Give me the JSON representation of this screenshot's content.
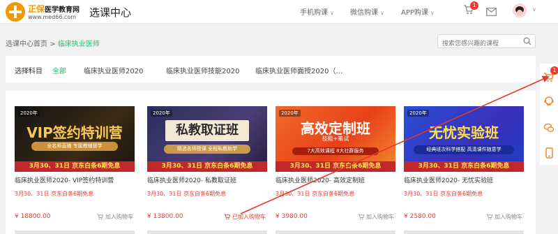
{
  "logo": {
    "brand_prefix": "正保",
    "brand_suffix": "医学教育网",
    "url": "www.med66.com"
  },
  "header": {
    "title": "选课中心",
    "nav": [
      {
        "label": "手机购课"
      },
      {
        "label": "微信购课"
      },
      {
        "label": "APP购课"
      }
    ],
    "cart_badge": "1"
  },
  "breadcrumb": {
    "home": "选课中心首页",
    "sep": ">",
    "current": "临床执业医师"
  },
  "search": {
    "placeholder": "搜索您感兴趣的课程"
  },
  "filter": {
    "label": "选择科目",
    "all": "全部",
    "options": [
      "临床执业医师2020",
      "临床执业医师技能2020",
      "临床执业医师面授2020（…"
    ]
  },
  "rail": {
    "cart_badge": "1"
  },
  "courses": [
    {
      "year": "2020年",
      "banner_title": "VIP签约特训营",
      "banner_sub": "全名师直播 专属教辅督学",
      "banner_strip": "3月30、31日  京东白条6期免息",
      "title": "临床执业医师2020- VIP签约特训营",
      "promo": "3月30、31日 京东白条6期免息",
      "price": "¥ 18800.00",
      "cart_label": "加入购物车"
    },
    {
      "year": "2020年",
      "banner_title": "私教取证班",
      "banner_sub": "精选名师授课 全程私教助学",
      "banner_strip": "3月30、31日  京东白条6期免息",
      "title": "临床执业医师2020- 私教取证班",
      "promo": "3月30、31日 京东白条6期免息",
      "price": "¥ 13800.00",
      "cart_label": "已加入购物车"
    },
    {
      "year": "2020年",
      "banner_title": "高效定制班",
      "banner_sub": "7大高效课程  8大社群服务",
      "banner_tag": "技能+笔试",
      "banner_strip": "3月30、31日  京东白条6期免息",
      "title": "临床执业医师2020- 高效定制班",
      "promo": "3月30、31日 京东白条6期免息",
      "price": "¥ 3980.00",
      "cart_label": "加入购物车"
    },
    {
      "year": "2020年",
      "banner_title": "无忧实验班",
      "banner_sub": "经典班次科学搭配 高清课件随意学",
      "banner_strip": "3月30、31日  京东白条6期免息",
      "title": "临床执业医师2020- 无忧实验班",
      "promo": "3月30、31日 京东白条6期免息",
      "price": "¥ 2580.00",
      "cart_label": "加入购物车"
    }
  ],
  "colors": {
    "accent_green": "#2eb872",
    "price_red": "#e83a2e",
    "brand_orange": "#f39800"
  },
  "icons": [
    "cart-icon",
    "mail-icon",
    "search-icon",
    "headset-icon",
    "wechat-icon",
    "phone-icon",
    "chevron-down-icon"
  ]
}
